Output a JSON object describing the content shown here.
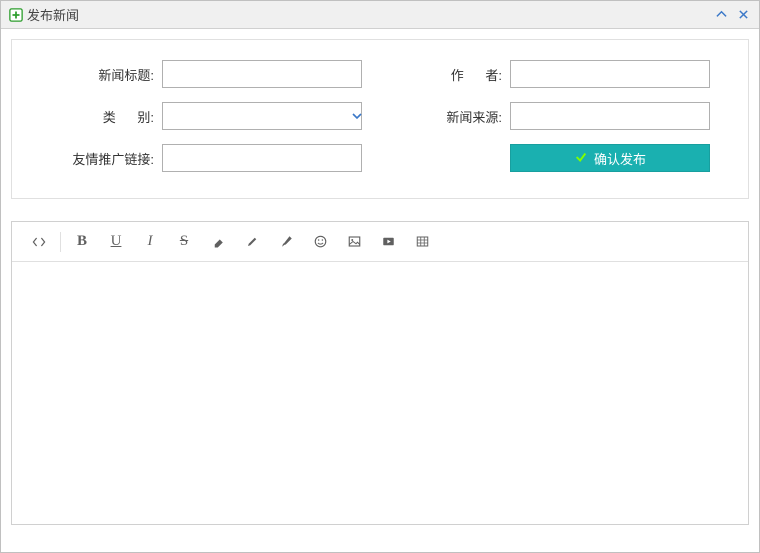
{
  "window": {
    "title": "发布新闻"
  },
  "form": {
    "title_label": "新闻标题:",
    "title_value": "",
    "author_label": "作      者:",
    "author_value": "",
    "category_label": "类      别:",
    "category_value": "",
    "source_label": "新闻来源:",
    "source_value": "",
    "link_label": "友情推广链接:",
    "link_value": "",
    "submit_label": "确认发布"
  },
  "editor": {
    "toolbar": {
      "code": "code-view",
      "bold": "B",
      "underline": "U",
      "italic": "I",
      "strike": "S"
    }
  }
}
